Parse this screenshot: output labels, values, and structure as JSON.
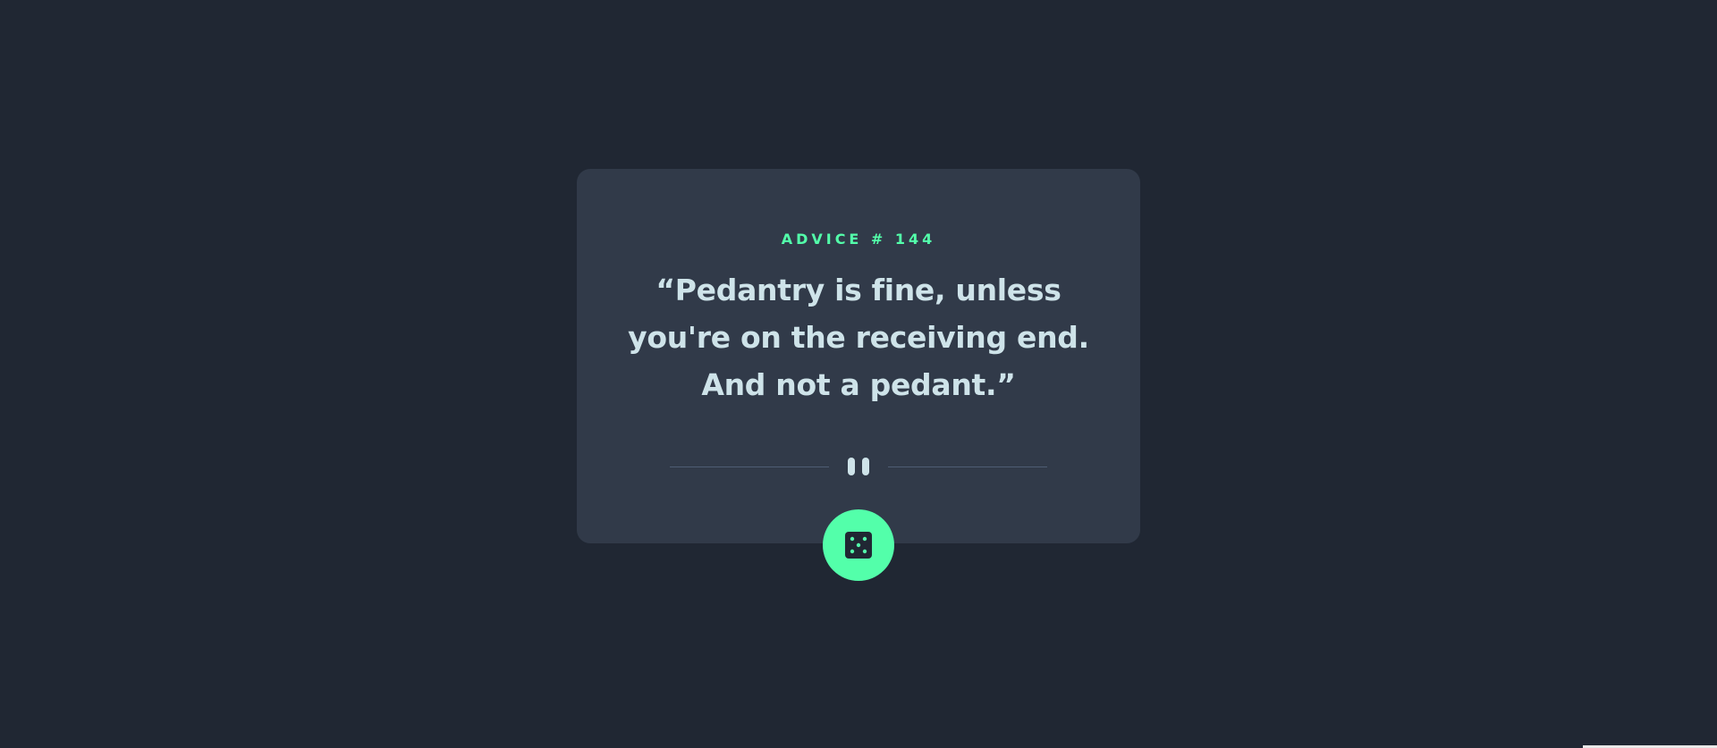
{
  "advice": {
    "id_label": "ADVICE # 144",
    "text": "“Pedantry is fine, unless you're on the receiving end. And not a pedant.”"
  },
  "divider": {
    "icon": "pause-icon"
  },
  "generate_button": {
    "icon": "dice-icon"
  },
  "colors": {
    "background": "#202733",
    "card": "#313a49",
    "accent": "#53ffaa",
    "text": "#cee3e9",
    "divider": "#4f5d74"
  }
}
